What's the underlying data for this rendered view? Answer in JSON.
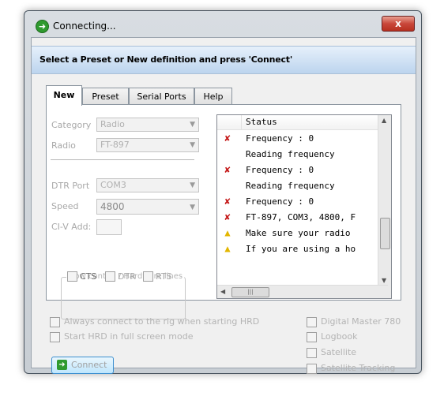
{
  "window": {
    "title": "Connecting...",
    "close_glyph": "x"
  },
  "banner": {
    "text": "Select a Preset or New definition and press 'Connect'"
  },
  "tabs": [
    {
      "label": "New"
    },
    {
      "label": "Preset"
    },
    {
      "label": "Serial Ports"
    },
    {
      "label": "Help"
    }
  ],
  "form": {
    "category_label": "Category",
    "category_value": "Radio",
    "radio_label": "Radio",
    "radio_value": "FT-897",
    "port_label": "DTR Port",
    "port_value": "COM3",
    "speed_label": "Speed",
    "speed_value": "4800",
    "civ_label": "CI-V Add:",
    "civ_value": ""
  },
  "flow": {
    "legend": "Flow control / Hardware lines",
    "cts": "CTS",
    "dtr": "DTR",
    "rts": "RTS"
  },
  "status": {
    "header": "Status",
    "rows": [
      {
        "icon": "error-x-icon",
        "text": "Frequency : 0"
      },
      {
        "icon": "",
        "text": "Reading frequency"
      },
      {
        "icon": "error-x-icon",
        "text": "Frequency : 0"
      },
      {
        "icon": "",
        "text": "Reading frequency"
      },
      {
        "icon": "error-x-icon",
        "text": "Frequency : 0"
      },
      {
        "icon": "error-x-icon",
        "text": "FT-897, COM3, 4800, F"
      },
      {
        "icon": "warning-icon",
        "text": "Make sure your radio"
      },
      {
        "icon": "warning-icon",
        "text": "If you are using a ho"
      }
    ]
  },
  "options_left": [
    {
      "label": "Always connect to the rig when starting HRD"
    },
    {
      "label": "Start HRD in full screen mode"
    }
  ],
  "options_right": [
    {
      "label": "Digital Master 780"
    },
    {
      "label": "Logbook"
    },
    {
      "label": "Satellite"
    },
    {
      "label": "Satellite Tracking"
    }
  ],
  "connect_button": {
    "label": "Connect"
  }
}
